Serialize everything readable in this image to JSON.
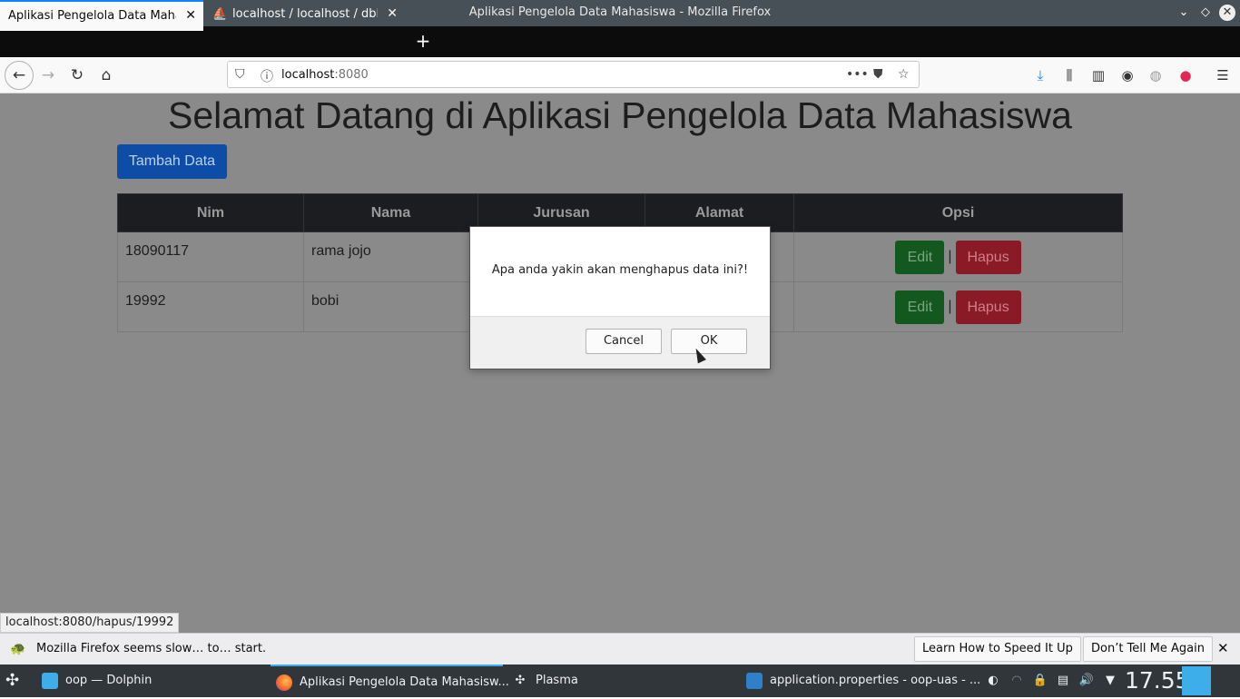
{
  "window": {
    "title": "Aplikasi Pengelola Data Mahasiswa - Mozilla Firefox"
  },
  "tabs": [
    {
      "label": "Aplikasi Pengelola Data Maha"
    },
    {
      "label": "localhost / localhost / dbM"
    }
  ],
  "urlbar": {
    "host": "localhost",
    "port": ":8080"
  },
  "page": {
    "heading": "Selamat Datang di Aplikasi Pengelola Data Mahasiswa",
    "add_button": "Tambah Data",
    "columns": [
      "Nim",
      "Nama",
      "Jurusan",
      "Alamat",
      "Opsi"
    ],
    "rows": [
      {
        "nim": "18090117",
        "nama": "rama jojo"
      },
      {
        "nim": "19992",
        "nama": "bobi"
      }
    ],
    "edit_label": "Edit",
    "delete_label": "Hapus",
    "separator": "|"
  },
  "dialog": {
    "message": "Apa anda yakin akan menghapus data ini?!",
    "cancel": "Cancel",
    "ok": "OK"
  },
  "statusbar": {
    "link": "localhost:8080/hapus/19992"
  },
  "notification": {
    "text": "Mozilla Firefox seems slow… to… start.",
    "learn": "Learn How to Speed It Up",
    "dont_tell": "Don’t Tell Me Again"
  },
  "taskbar": {
    "tasks": [
      {
        "label": "oop — Dolphin"
      },
      {
        "label": "Aplikasi Pengelola Data Mahasisw..."
      },
      {
        "label": "Plasma"
      },
      {
        "label": "application.properties - oop-uas - ..."
      }
    ],
    "clock": "17.55"
  },
  "colors": {
    "accent": "#0a84ff",
    "add_button": "#0d4da8",
    "edit": "#13581f",
    "hapus": "#8a1a25"
  }
}
